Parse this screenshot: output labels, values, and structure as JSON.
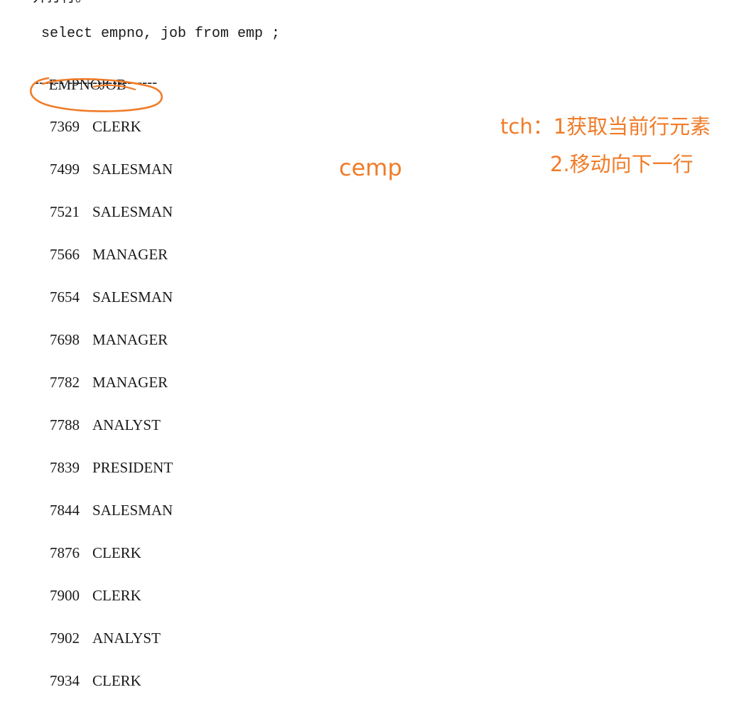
{
  "clipped_top_text": "并打行。",
  "sql_statement": "select empno, job from emp ;",
  "result": {
    "headers": {
      "empno": "EMPNO",
      "job": "JOB"
    },
    "separator": "------ ------------------",
    "rows": [
      {
        "empno": "7369",
        "job": "CLERK"
      },
      {
        "empno": "7499",
        "job": "SALESMAN"
      },
      {
        "empno": "7521",
        "job": "SALESMAN"
      },
      {
        "empno": "7566",
        "job": "MANAGER"
      },
      {
        "empno": "7654",
        "job": "SALESMAN"
      },
      {
        "empno": "7698",
        "job": "MANAGER"
      },
      {
        "empno": "7782",
        "job": "MANAGER"
      },
      {
        "empno": "7788",
        "job": "ANALYST"
      },
      {
        "empno": "7839",
        "job": "PRESIDENT"
      },
      {
        "empno": "7844",
        "job": "SALESMAN"
      },
      {
        "empno": "7876",
        "job": "CLERK"
      },
      {
        "empno": "7900",
        "job": "CLERK"
      },
      {
        "empno": "7902",
        "job": "ANALYST"
      },
      {
        "empno": "7934",
        "job": "CLERK"
      }
    ]
  },
  "annotations": {
    "cursor_name": "cemp",
    "step1": "tch：1获取当前行元素",
    "step2": "2.移动向下一行",
    "color": "#f07c28"
  }
}
